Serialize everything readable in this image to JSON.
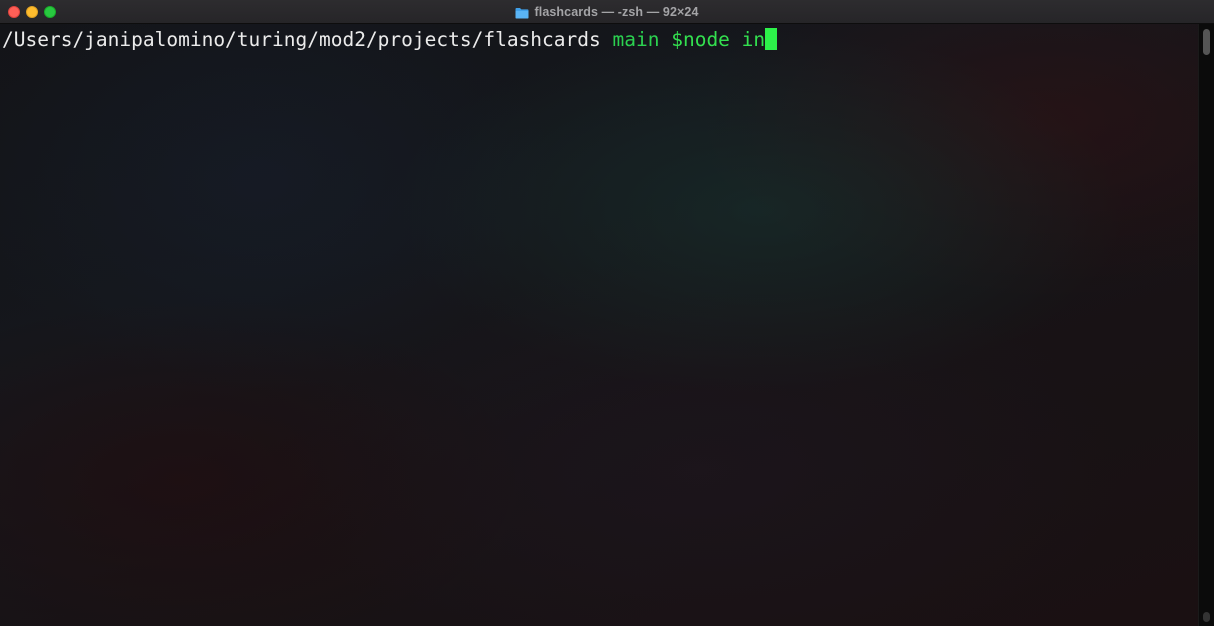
{
  "window": {
    "title": "flashcards — -zsh — 92×24",
    "title_icon": "folder-icon",
    "controls": [
      "close-button",
      "minimize-button",
      "maximize-button"
    ]
  },
  "terminal": {
    "prompt": {
      "path": "/Users/janipalomino/turing/mod2/projects/flashcards",
      "branch": "main",
      "command": "$node in"
    }
  },
  "colors": {
    "branch": "#2bd150",
    "command": "#33e04f",
    "cursor": "#2df24a",
    "close": "#fe5f57",
    "minimize": "#febc2e",
    "maximize": "#28c840"
  }
}
